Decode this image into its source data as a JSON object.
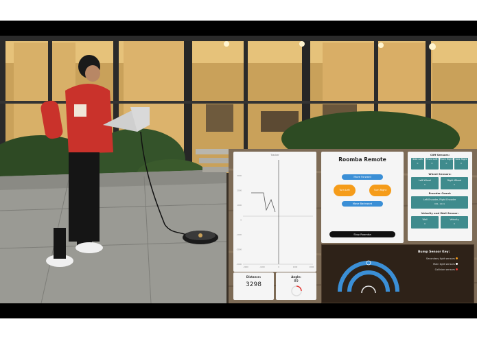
{
  "remote": {
    "title": "Roomba Remote",
    "move_forward": "Move Forward",
    "turn_left": "Turn Left",
    "turn_right": "Turn Right",
    "move_backward": "Move Backward",
    "stop": "Stop Roomba"
  },
  "tracker": {
    "title": "Tracker",
    "y_ticks": [
      "3000",
      "2000",
      "1000",
      "0",
      "-1000",
      "-2000",
      "-3000"
    ],
    "x_ticks": [
      "-2000",
      "-1000",
      "0",
      "1000",
      "2000"
    ]
  },
  "stats": {
    "distance_label": "Distance:",
    "distance_value": "3298",
    "angle_label": "Angle:",
    "angle_value": "89"
  },
  "sensors": {
    "cliff_title": "Cliff Sensors:",
    "cliff": [
      {
        "label": "Side Left",
        "value": "0"
      },
      {
        "label": "Front Left",
        "value": "0"
      },
      {
        "label": "Front Right",
        "value": "0"
      },
      {
        "label": "Side Right",
        "value": "0"
      }
    ],
    "wheel_title": "Wheel Sensors:",
    "wheel": [
      {
        "label": "Left Wheel",
        "value": "0"
      },
      {
        "label": "Right Wheel",
        "value": "0"
      }
    ],
    "encoder_title": "Encoder Count:",
    "encoder": {
      "label": "Left Encoder, Right Encoder",
      "value": "961, 1241"
    },
    "velocity_title": "Velocity and Wall Sensor:",
    "velocity": [
      {
        "label": "Wall",
        "value": "0"
      },
      {
        "label": "Velocity",
        "value": "0"
      }
    ]
  },
  "bump": {
    "title": "Bump Sensor Key:",
    "items": [
      {
        "label": "Secondary light sensors",
        "color": "#f59c1a"
      },
      {
        "label": "Main light sensors",
        "color": "#ffffff"
      },
      {
        "label": "Collision sensors",
        "color": "#e53935"
      }
    ]
  },
  "colors": {
    "button_blue": "#3b8fd6",
    "button_orange": "#f59c1a",
    "sensor_teal": "#3f8b8d",
    "stop_black": "#111111",
    "gauge_blue": "#3b8fd6"
  }
}
